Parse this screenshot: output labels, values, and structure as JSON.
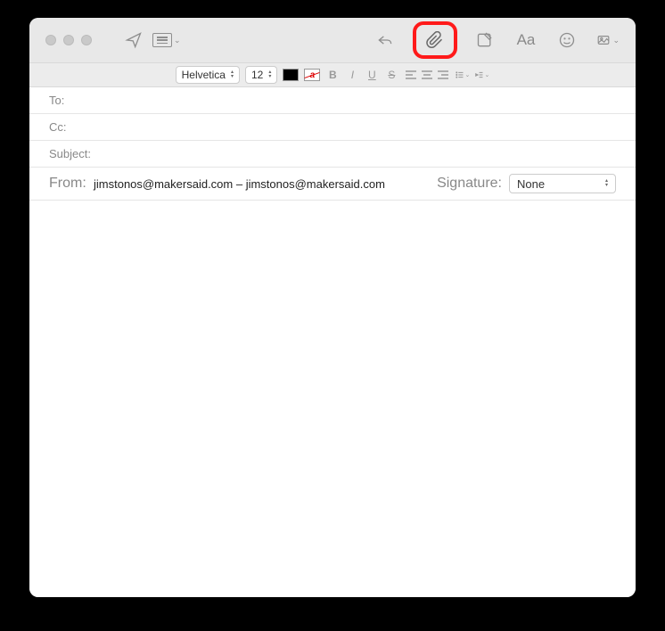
{
  "format": {
    "font": "Helvetica",
    "size": "12",
    "bold": "B",
    "italic": "I",
    "underline": "U",
    "strike": "S"
  },
  "fields": {
    "to_label": "To:",
    "cc_label": "Cc:",
    "subject_label": "Subject:",
    "from_label": "From:",
    "from_value": "jimstonos@makersaid.com – jimstonos@makersaid.com",
    "signature_label": "Signature:",
    "signature_value": "None"
  },
  "toolbar": {
    "font_label": "Aa"
  }
}
